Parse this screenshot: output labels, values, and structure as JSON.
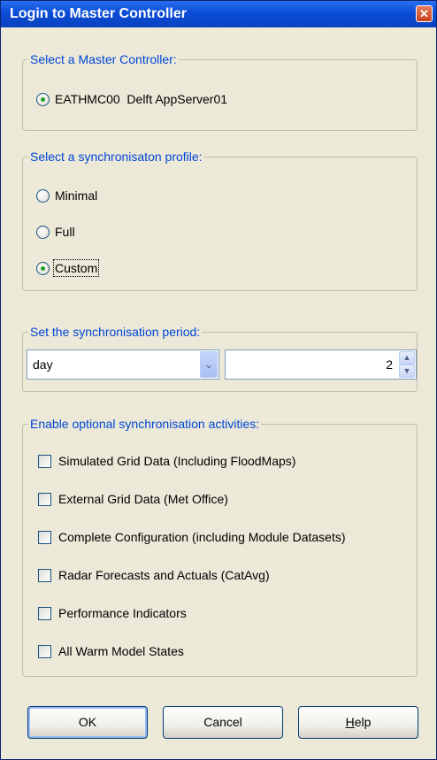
{
  "window": {
    "title": "Login to Master Controller",
    "close_glyph": "✕"
  },
  "master": {
    "legend": "Select a Master Controller:",
    "option_label": "EATHMC00  Delft AppServer01",
    "selected": true
  },
  "profile": {
    "legend": "Select a synchronisaton profile:",
    "options": [
      {
        "label": "Minimal",
        "selected": false
      },
      {
        "label": "Full",
        "selected": false
      },
      {
        "label": "Custom",
        "selected": true
      }
    ]
  },
  "period": {
    "legend": "Set the synchronisation period:",
    "unit_value": "day",
    "amount_value": "2",
    "dropdown_icon": "chevron-down-icon"
  },
  "activities": {
    "legend": "Enable optional synchronisation activities:",
    "items": [
      {
        "label": "Simulated Grid Data (Including FloodMaps)",
        "checked": false
      },
      {
        "label": "External Grid Data (Met Office)",
        "checked": false
      },
      {
        "label": "Complete Configuration (including Module Datasets)",
        "checked": false
      },
      {
        "label": "Radar Forecasts and Actuals (CatAvg)",
        "checked": false
      },
      {
        "label": "Performance Indicators",
        "checked": false
      },
      {
        "label": "All Warm Model States",
        "checked": false
      }
    ]
  },
  "buttons": {
    "ok": "OK",
    "cancel": "Cancel",
    "help_prefix": "H",
    "help_rest": "elp"
  },
  "colors": {
    "title_bar": "#0a4cd6",
    "legend_text": "#0046d5",
    "dialog_bg": "#ece9d8"
  }
}
